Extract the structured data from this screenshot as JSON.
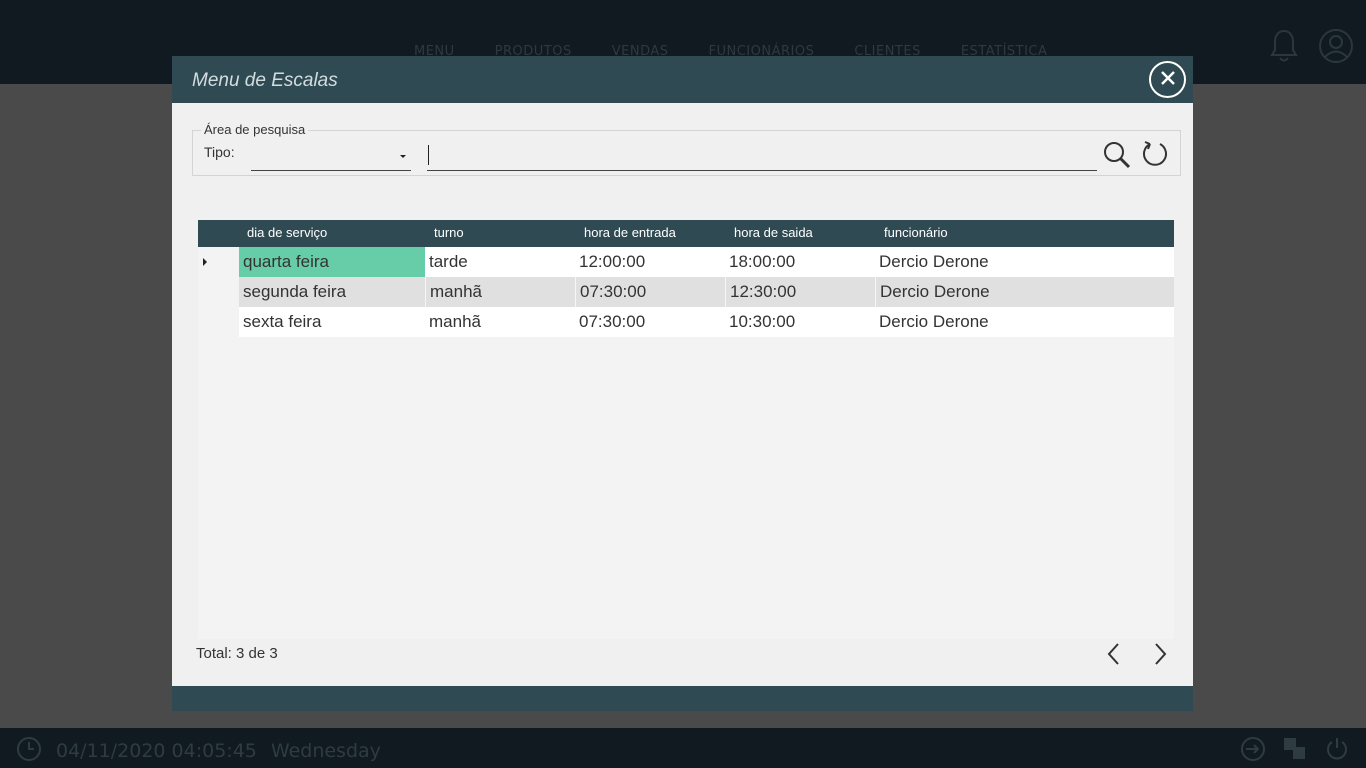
{
  "app": {
    "nav": [
      "MENU",
      "PRODUTOS",
      "VENDAS",
      "FUNCIONÁRIOS",
      "CLIENTES",
      "ESTATÍSTICA"
    ],
    "status_datetime": "04/11/2020 04:05:45",
    "status_weekday": "Wednesday"
  },
  "dialog": {
    "title": "Menu de Escalas",
    "search": {
      "group_label": "Área de pesquisa",
      "tipo_label": "Tipo:",
      "tipo_value": "",
      "query_value": ""
    },
    "table": {
      "columns": [
        "dia de serviço",
        "turno",
        "hora de entrada",
        "hora de saida",
        "funcionário"
      ],
      "rows": [
        [
          "quarta feira",
          "tarde",
          "12:00:00",
          "18:00:00",
          "Dercio Derone"
        ],
        [
          "segunda feira",
          "manhã",
          "07:30:00",
          "12:30:00",
          "Dercio Derone"
        ],
        [
          "sexta feira",
          "manhã",
          "07:30:00",
          "10:30:00",
          "Dercio Derone"
        ]
      ]
    },
    "total_label": "Total: 3 de 3"
  },
  "colors": {
    "header_bg": "#2f4a53",
    "selected_cell": "#66cda8",
    "topbar_bg": "#101a20"
  }
}
